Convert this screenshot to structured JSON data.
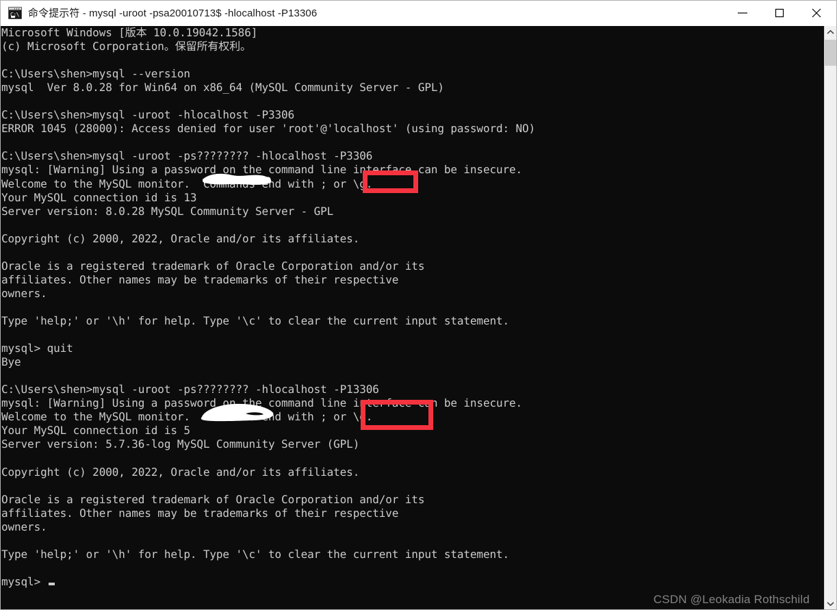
{
  "window": {
    "title": "命令提示符 - mysql  -uroot -psa20010713$ -hlocalhost -P13306",
    "icon": "cmd-prompt-icon",
    "icon_prompt_text": "C:\\",
    "background_color": "#0c0c0c",
    "text_color": "#cccccc",
    "titlebar_background": "#ffffff",
    "controls": {
      "minimize_label": "Minimize",
      "maximize_label": "Maximize",
      "close_label": "Close"
    }
  },
  "terminal": {
    "lines": [
      "Microsoft Windows [版本 10.0.19042.1586]",
      "(c) Microsoft Corporation。保留所有权利。",
      "",
      "C:\\Users\\shen>mysql --version",
      "mysql  Ver 8.0.28 for Win64 on x86_64 (MySQL Community Server - GPL)",
      "",
      "C:\\Users\\shen>mysql -uroot -hlocalhost -P3306",
      "ERROR 1045 (28000): Access denied for user 'root'@'localhost' (using password: NO)",
      "",
      "C:\\Users\\shen>mysql -uroot -ps???????? -hlocalhost -P3306",
      "mysql: [Warning] Using a password on the command line interface can be insecure.",
      "Welcome to the MySQL monitor.  Commands end with ; or \\g.",
      "Your MySQL connection id is 13",
      "Server version: 8.0.28 MySQL Community Server - GPL",
      "",
      "Copyright (c) 2000, 2022, Oracle and/or its affiliates.",
      "",
      "Oracle is a registered trademark of Oracle Corporation and/or its",
      "affiliates. Other names may be trademarks of their respective",
      "owners.",
      "",
      "Type 'help;' or '\\h' for help. Type '\\c' to clear the current input statement.",
      "",
      "mysql> quit",
      "Bye",
      "",
      "C:\\Users\\shen>mysql -uroot -ps???????? -hlocalhost -P13306",
      "mysql: [Warning] Using a password on the command line interface can be insecure.",
      "Welcome to the MySQL monitor.  Commands end with ; or \\g.",
      "Your MySQL connection id is 5",
      "Server version: 5.7.36-log MySQL Community Server (GPL)",
      "",
      "Copyright (c) 2000, 2022, Oracle and/or its affiliates.",
      "",
      "Oracle is a registered trademark of Oracle Corporation and/or its",
      "affiliates. Other names may be trademarks of their respective",
      "owners.",
      "",
      "Type 'help;' or '\\h' for help. Type '\\c' to clear the current input statement.",
      "",
      "mysql> "
    ],
    "cursor_visible": true
  },
  "annotations": {
    "color": "#f5333f",
    "boxes": [
      {
        "label": "-P3306",
        "note": "highlighted port on first mysql connection"
      },
      {
        "label": "-P13306",
        "note": "highlighted port on second mysql connection"
      }
    ],
    "redactions": [
      {
        "note": "password obscured with white scribble (first command)"
      },
      {
        "note": "password obscured with white scribble (second command)"
      }
    ]
  },
  "watermark": {
    "text": "CSDN @Leokadia Rothschild"
  },
  "scrollbar": {
    "up_arrow": "chevron-up-icon",
    "down_arrow": "chevron-down-icon",
    "thumb_position": "near-top"
  }
}
